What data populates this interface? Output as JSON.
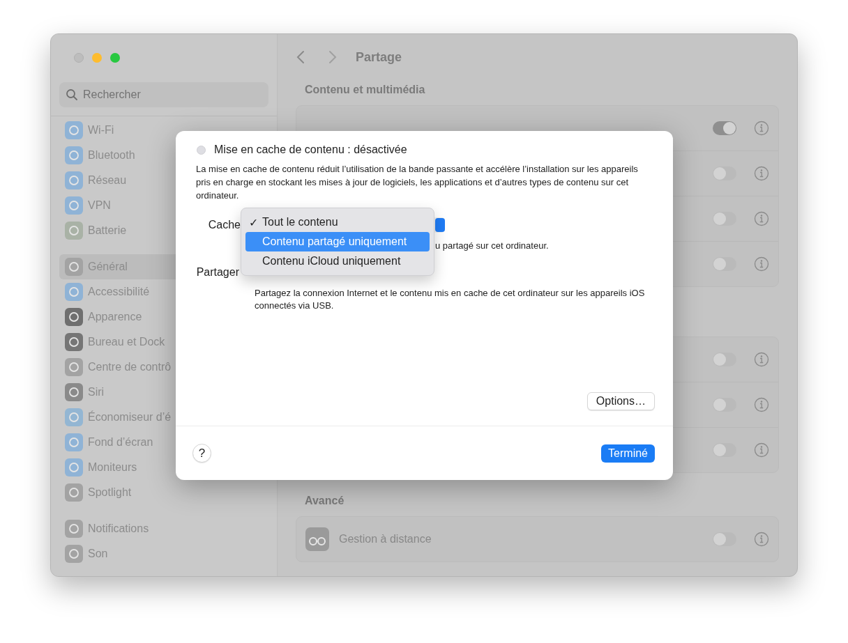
{
  "window": {
    "title": "Partage"
  },
  "sidebar": {
    "search": {
      "placeholder": "Rechercher"
    },
    "groups": [
      {
        "items": [
          {
            "label": "Wi-Fi",
            "selected": false,
            "color": "#8fb3d6"
          },
          {
            "label": "Bluetooth",
            "selected": false,
            "color": "#8fb3d6"
          },
          {
            "label": "Réseau",
            "selected": false,
            "color": "#8fb3d6"
          },
          {
            "label": "VPN",
            "selected": false,
            "color": "#8fb3d6"
          },
          {
            "label": "Batterie",
            "selected": false,
            "color": "#a9b2a6"
          }
        ]
      },
      {
        "items": [
          {
            "label": "Général",
            "selected": true,
            "color": "#a3a3a3"
          },
          {
            "label": "Accessibilité",
            "selected": false,
            "color": "#8fb3d6"
          },
          {
            "label": "Apparence",
            "selected": false,
            "color": "#6f6f6f"
          },
          {
            "label": "Bureau et Dock",
            "selected": false,
            "color": "#767676"
          },
          {
            "label": "Centre de contrô",
            "selected": false,
            "color": "#a3a3a3"
          },
          {
            "label": "Siri",
            "selected": false,
            "color": "#8a8a8a"
          },
          {
            "label": "Économiseur d’é",
            "selected": false,
            "color": "#93b6d3"
          },
          {
            "label": "Fond d’écran",
            "selected": false,
            "color": "#8fb3d6"
          },
          {
            "label": "Moniteurs",
            "selected": false,
            "color": "#8fb3d6"
          },
          {
            "label": "Spotlight",
            "selected": false,
            "color": "#a3a3a3"
          }
        ]
      },
      {
        "items": [
          {
            "label": "Notifications",
            "selected": false,
            "color": "#a3a3a3"
          },
          {
            "label": "Son",
            "selected": false,
            "color": "#a3a3a3"
          }
        ]
      }
    ]
  },
  "sections": [
    {
      "heading": "Contenu et multimédia",
      "rows": [
        {
          "on": true
        },
        {
          "on": false
        },
        {
          "on": false
        },
        {
          "on": false
        }
      ]
    },
    {
      "rows": [
        {
          "on": false
        },
        {
          "on": false
        },
        {
          "on": false
        }
      ]
    },
    {
      "heading": "Avancé",
      "rows": [
        {
          "label": "Gestion à distance",
          "on": false,
          "color": "#9a9a9a"
        }
      ]
    }
  ],
  "dialog": {
    "status": {
      "label": "Mise en cache de contenu : désactivée",
      "on": false
    },
    "description": "La mise en cache de contenu réduit l’utilisation de la bande passante et accélère l’installation sur les appareils pris en charge en stockant les mises à jour de logiciels, les applications et d’autres types de contenu sur cet ordinateur.",
    "cache_label": "Cache",
    "cache_hint": "u partagé sur cet ordinateur.",
    "share_label": "Partager",
    "share_description": "Partagez la connexion Internet et le contenu mis en cache de cet ordinateur sur les appareils iOS connectés via USB.",
    "options_button": "Options…",
    "help_button": "?",
    "done_button": "Terminé"
  },
  "menu": {
    "check": "✓",
    "items": [
      {
        "label": "Tout le contenu",
        "checked": true,
        "selected": false
      },
      {
        "label": "Contenu partagé uniquement",
        "checked": false,
        "selected": true
      },
      {
        "label": "Contenu iCloud uniquement",
        "checked": false,
        "selected": false
      }
    ]
  }
}
